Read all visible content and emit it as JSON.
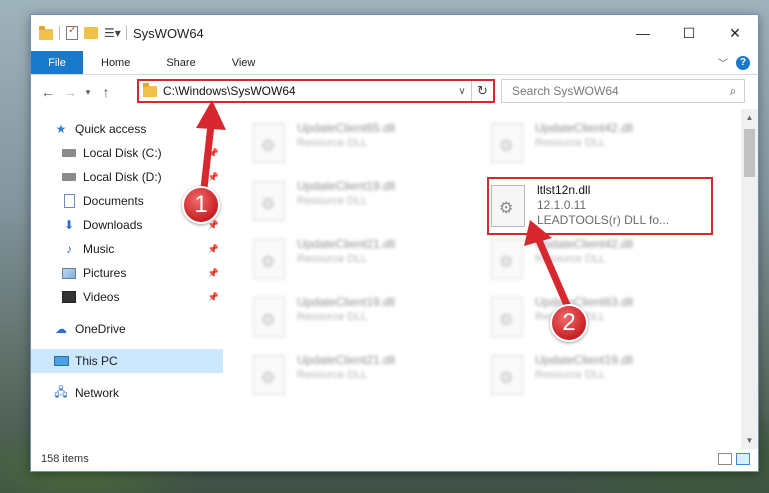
{
  "window": {
    "title": "SysWOW64",
    "controls": {
      "minimize": "—",
      "maximize": "☐",
      "close": "✕"
    }
  },
  "ribbon": {
    "file": "File",
    "tabs": [
      "Home",
      "Share",
      "View"
    ],
    "help": "?"
  },
  "nav": {
    "address": "C:\\Windows\\SysWOW64",
    "search_placeholder": "Search SysWOW64"
  },
  "sidebar": {
    "items": [
      {
        "label": "Quick access",
        "icon": "star-icon"
      },
      {
        "label": "Local Disk (C:)",
        "icon": "drive-icon"
      },
      {
        "label": "Local Disk (D:)",
        "icon": "drive-icon"
      },
      {
        "label": "Documents",
        "icon": "documents-icon"
      },
      {
        "label": "Downloads",
        "icon": "downloads-icon"
      },
      {
        "label": "Music",
        "icon": "music-icon"
      },
      {
        "label": "Pictures",
        "icon": "pictures-icon"
      },
      {
        "label": "Videos",
        "icon": "videos-icon"
      },
      {
        "label": "OneDrive",
        "icon": "onedrive-icon"
      },
      {
        "label": "This PC",
        "icon": "this-pc-icon"
      },
      {
        "label": "Network",
        "icon": "network-icon"
      }
    ]
  },
  "files": {
    "blurred": [
      {
        "name": "UpdateClient65.dll",
        "type": "Resource DLL"
      },
      {
        "name": "UpdateClient42.dll",
        "type": "Resource DLL"
      },
      {
        "name": "UpdateClient19.dll",
        "type": "Resource DLL"
      },
      {
        "name": "UpdateClient21.dll",
        "type": "Resource DLL"
      },
      {
        "name": "UpdateClient42.dll",
        "type": "Resource DLL"
      },
      {
        "name": "UpdateClient19.dll",
        "type": "Resource DLL"
      },
      {
        "name": "UpdateClient63.dll",
        "type": "Resource DLL"
      },
      {
        "name": "UpdateClient21.dll",
        "type": "Resource DLL"
      },
      {
        "name": "UpdateClient19.dll",
        "type": "Resource DLL"
      }
    ],
    "highlighted": {
      "name": "ltlst12n.dll",
      "version": "12.1.0.11",
      "description": "LEADTOOLS(r) DLL fo..."
    }
  },
  "status": {
    "items": "158 items"
  },
  "annotations": {
    "badge1": "1",
    "badge2": "2",
    "color": "#d8282f"
  }
}
